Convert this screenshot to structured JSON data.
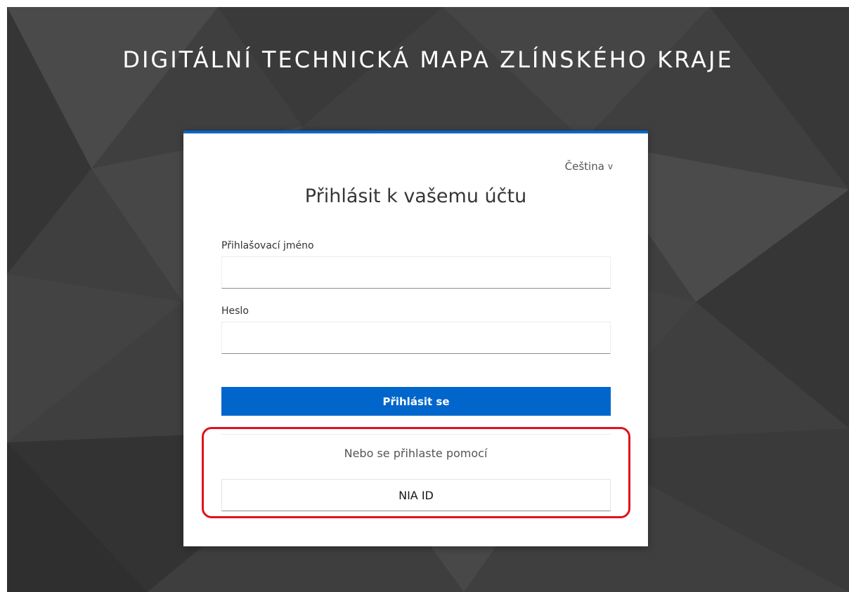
{
  "header": {
    "title": "DIGITÁLNÍ TECHNICKÁ MAPA ZLÍNSKÉHO KRAJE"
  },
  "card": {
    "language": {
      "label": "Čeština",
      "chevron": "v"
    },
    "title": "Přihlásit k vašemu účtu",
    "username": {
      "label": "Přihlašovací jméno",
      "value": "",
      "placeholder": ""
    },
    "password": {
      "label": "Heslo",
      "value": "",
      "placeholder": ""
    },
    "submit_label": "Přihlásit se",
    "alternative": {
      "text": "Nebo se přihlaste pomocí",
      "providers": [
        {
          "label": "NIA ID"
        }
      ]
    }
  },
  "colors": {
    "accent": "#0066cc",
    "highlight_outline": "#e0121e",
    "background": "#3f3f3f"
  }
}
